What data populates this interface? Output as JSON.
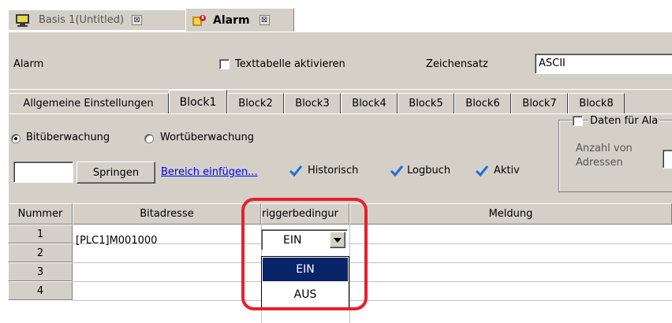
{
  "doc_tabs": [
    {
      "label": "Basis 1(Untitled)",
      "active": false,
      "close": "⊠"
    },
    {
      "label": "Alarm",
      "active": true,
      "close": "⊠"
    }
  ],
  "toolbar": {
    "title": "Alarm",
    "texttable_label": "Texttabelle aktivieren",
    "charset_label": "Zeichensatz",
    "charset_value": "ASCII"
  },
  "block_tabs": [
    "Allgemeine Einstellungen",
    "Block1",
    "Block2",
    "Block3",
    "Block4",
    "Block5",
    "Block6",
    "Block7",
    "Block8"
  ],
  "active_block": "Block1",
  "monitoring": {
    "bit_label": "Bitüberwachung",
    "word_label": "Wortüberwachung",
    "selected": "Bitüberwachung"
  },
  "controls": {
    "jump_input": "",
    "jump_label": "Springen",
    "insert_range_label": "Bereich einfügen...",
    "historic_label": "Historisch",
    "logbook_label": "Logbuch",
    "active_label": "Aktiv"
  },
  "data_group": {
    "checkbox_label": "Daten für Ala",
    "count_label_1": "Anzahl von",
    "count_label_2": "Adressen"
  },
  "table": {
    "columns": [
      "Nummer",
      "Bitadresse",
      "riggerbedingur",
      "Meldung"
    ],
    "rows": [
      {
        "num": "1",
        "address": "[PLC1]M001000",
        "trigger": "EIN",
        "message": ""
      },
      {
        "num": "2",
        "address": "",
        "trigger": "",
        "message": ""
      },
      {
        "num": "3",
        "address": "",
        "trigger": "",
        "message": ""
      },
      {
        "num": "4",
        "address": "",
        "trigger": "",
        "message": ""
      }
    ]
  },
  "dropdown": {
    "options": [
      "EIN",
      "AUS"
    ],
    "highlighted": "EIN"
  },
  "colors": {
    "highlight_ring": "#e8202a",
    "selection": "#0a246a",
    "check": "#1e6fd9"
  }
}
